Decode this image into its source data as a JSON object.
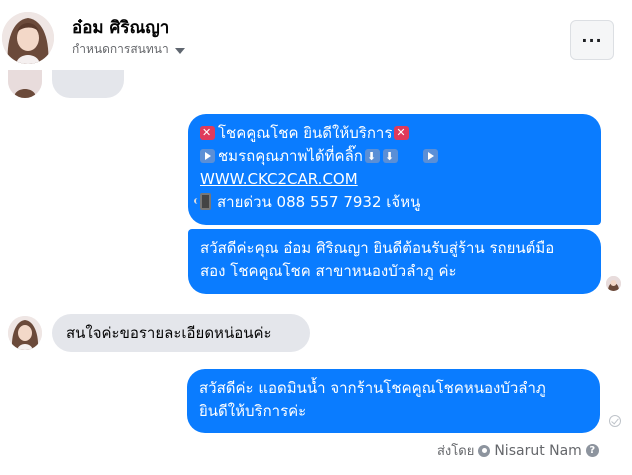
{
  "header": {
    "name": "อ๋อม ศิริณญา",
    "subtitle": "กำหนดการสนทนา",
    "more_label": "···"
  },
  "messages": {
    "outgoing_1": {
      "line1_text": "โชคคูณโชค ยินดีให้บริการ",
      "line2_text": "ชมรถคุณภาพได้ที่คลิ๊ก",
      "url": "WWW.CKC2CAR.COM",
      "line4_text": "สายด่วน 088 557 7932 เจ้หนู"
    },
    "outgoing_2": {
      "line1": "สวัสดีค่ะคุณ อ๋อม ศิริณญา ยินดีต้อนรับสู่ร้าน รถยนต์มือ",
      "line2": "สอง โชคคูณโชค สาขาหนองบัวลำภู ค่ะ"
    },
    "incoming_1": {
      "text": "สนใจค่ะขอรายละเอียดหน่อนค่ะ"
    },
    "outgoing_3": {
      "line1": "สวัสดีค่ะ แอดมินน้ำ จากร้านโชคคูณโชคหนองบัวลำภู",
      "line2": "ยินดีให้บริการค่ะ"
    }
  },
  "footer": {
    "sent_by_label": "ส่งโดย",
    "sender_name": "Nisarut Nam",
    "help_label": "?"
  },
  "colors": {
    "outgoing_bubble": "#0a7cff",
    "incoming_bubble": "#e4e6eb"
  }
}
